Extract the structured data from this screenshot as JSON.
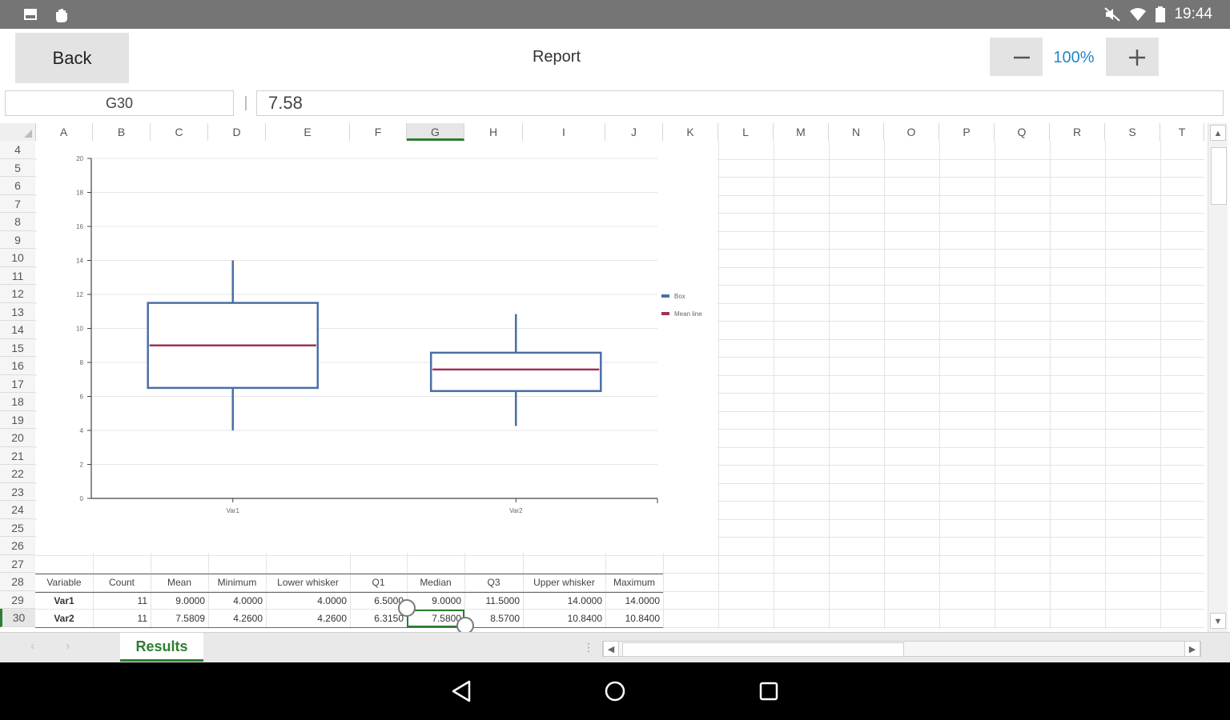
{
  "status_bar": {
    "time": "19:44",
    "left_icons": [
      "image-icon",
      "hand-icon"
    ],
    "right_icons": [
      "mute-icon",
      "wifi-icon",
      "battery-icon"
    ]
  },
  "toolbar": {
    "back_label": "Back",
    "title": "Report",
    "zoom_minus": "−",
    "zoom_level": "100%",
    "zoom_plus": "+"
  },
  "formula_bar": {
    "cell_ref": "G30",
    "separator": "|",
    "value": "7.58"
  },
  "columns": [
    "A",
    "B",
    "C",
    "D",
    "E",
    "F",
    "G",
    "H",
    "I",
    "J",
    "K",
    "L",
    "M",
    "N",
    "O",
    "P",
    "Q",
    "R",
    "S",
    "T"
  ],
  "selected_column": "G",
  "rows": [
    "4",
    "5",
    "6",
    "7",
    "8",
    "9",
    "10",
    "11",
    "12",
    "13",
    "14",
    "15",
    "16",
    "17",
    "18",
    "19",
    "20",
    "21",
    "22",
    "23",
    "24",
    "25",
    "26",
    "27",
    "28",
    "29",
    "30"
  ],
  "selected_row": "30",
  "chart_data": {
    "type": "box",
    "categories": [
      "Var1",
      "Var2"
    ],
    "boxes": [
      {
        "min": 4.0,
        "q1": 6.5,
        "median": 9.0,
        "q3": 11.5,
        "max": 14.0,
        "mean": 9.0
      },
      {
        "min": 4.26,
        "q1": 6.315,
        "median": 7.58,
        "q3": 8.57,
        "max": 10.84,
        "mean": 7.58
      }
    ],
    "ylim": [
      0,
      20
    ],
    "yticks": [
      "0",
      "2",
      "4",
      "6",
      "8",
      "10",
      "12",
      "14",
      "16",
      "18",
      "20"
    ],
    "legend": [
      {
        "label": "Box",
        "color": "#4a6fa5"
      },
      {
        "label": "Mean line",
        "color": "#a0305a"
      }
    ],
    "legend_position": "right",
    "grid": true
  },
  "table": {
    "headers": [
      "Variable",
      "Count",
      "Mean",
      "Minimum",
      "Lower whisker",
      "Q1",
      "Median",
      "Q3",
      "Upper whisker",
      "Maximum"
    ],
    "rows": [
      [
        "Var1",
        "11",
        "9.0000",
        "4.0000",
        "4.0000",
        "6.5000",
        "9.0000",
        "11.5000",
        "14.0000",
        "14.0000"
      ],
      [
        "Var2",
        "11",
        "7.5809",
        "4.2600",
        "4.2600",
        "6.3150",
        "7.5800",
        "8.5700",
        "10.8400",
        "10.8400"
      ]
    ]
  },
  "sheets": {
    "prev": "‹",
    "next": "›",
    "active": "Results",
    "menu": "⋮"
  },
  "scroll_arrows": {
    "up": "▲",
    "down": "▼",
    "left": "◀",
    "right": "▶"
  }
}
